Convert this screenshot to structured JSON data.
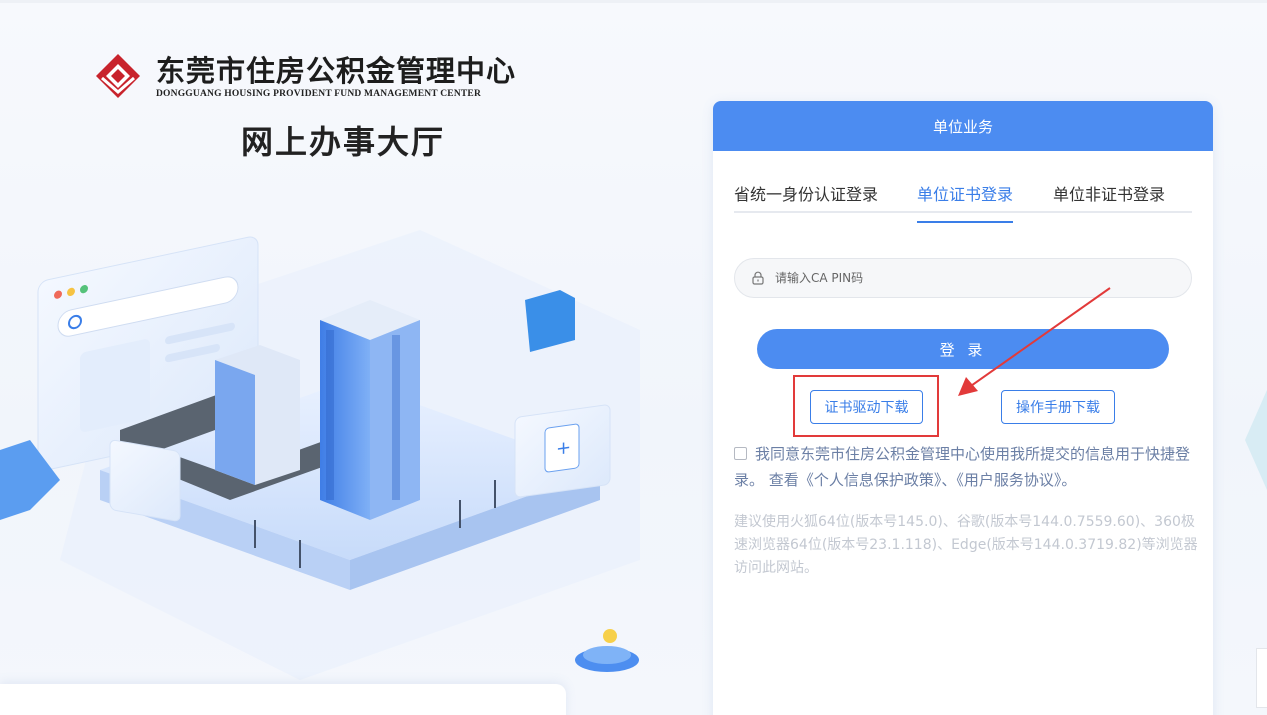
{
  "logo": {
    "title": "东莞市住房公积金管理中心",
    "subtitle": "DONGGUANG HOUSING PROVIDENT FUND MANAGEMENT CENTER"
  },
  "hall_title": "网上办事大厅",
  "panel": {
    "header": "单位业务",
    "tabs": [
      {
        "label": "省统一身份认证登录",
        "active": false
      },
      {
        "label": "单位证书登录",
        "active": true
      },
      {
        "label": "单位非证书登录",
        "active": false
      }
    ],
    "pin_placeholder": "请输入CA PIN码",
    "login_label": "登 录",
    "cert_driver_download": "证书驱动下载",
    "manual_download": "操作手册下载",
    "agree_text": "我同意东莞市住房公积金管理中心使用我所提交的信息用于快捷登录。",
    "agree_view": "查看",
    "privacy_policy": "《个人信息保护政策》",
    "separator": "、",
    "user_agreement": "《用户服务协议》",
    "period": "。",
    "browser_hint": "建议使用火狐64位(版本号145.0)、谷歌(版本号144.0.7559.60)、360极速浏览器64位(版本号23.1.118)、Edge(版本号144.0.3719.82)等浏览器访问此网站。"
  },
  "colors": {
    "primary": "#4c8cf1",
    "tab_active": "#3a7ee8",
    "highlight": "#e23a3a",
    "logo_red": "#c8232c"
  }
}
